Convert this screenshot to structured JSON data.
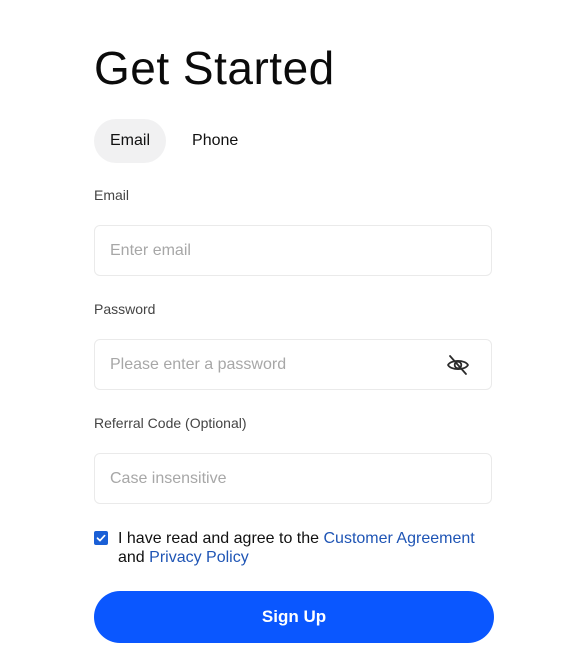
{
  "title": "Get Started",
  "tabs": [
    {
      "label": "Email",
      "active": true
    },
    {
      "label": "Phone",
      "active": false
    }
  ],
  "email": {
    "label": "Email",
    "placeholder": "Enter email",
    "value": ""
  },
  "password": {
    "label": "Password",
    "placeholder": "Please enter a password",
    "value": "",
    "toggle_icon": "eye-slash-icon"
  },
  "referral": {
    "label": "Referral Code (Optional)",
    "placeholder": "Case insensitive",
    "value": ""
  },
  "agreement": {
    "checked": true,
    "text_before": "I have read and agree to the",
    "link1": "Customer Agreement",
    "text_and": "and",
    "link2": "Privacy Policy"
  },
  "signup_label": "Sign Up",
  "colors": {
    "primary": "#0a57ff",
    "link": "#1f55b5",
    "checkbox": "#1a5fd6",
    "tab_active_bg": "#f1f1f2"
  }
}
